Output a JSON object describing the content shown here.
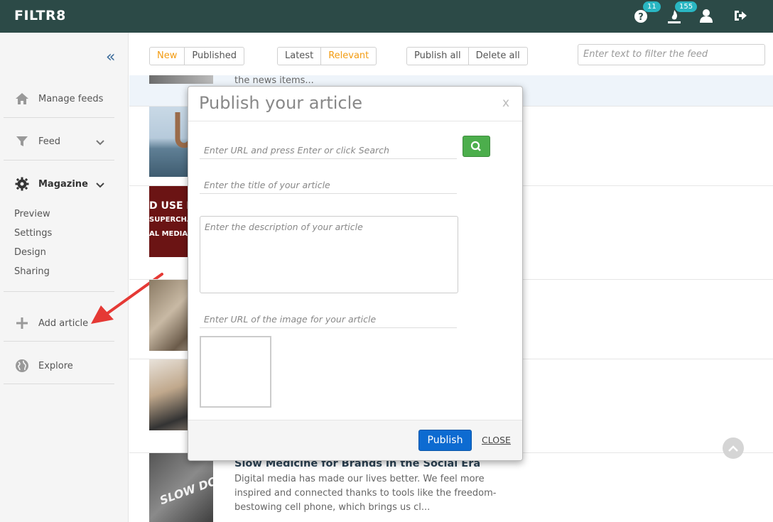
{
  "app": {
    "logo": "FILTR8"
  },
  "topbar": {
    "help_badge": "11",
    "notifications_badge": "155",
    "icons": [
      "question-circle-icon",
      "fire-icon",
      "user-icon",
      "sign-out-icon"
    ]
  },
  "sidebar": {
    "manage_feeds": "Manage feeds",
    "feed": "Feed",
    "magazine": "Magazine",
    "magazine_items": [
      "Preview",
      "Settings",
      "Design",
      "Sharing"
    ],
    "add_article": "Add article",
    "explore": "Explore"
  },
  "toolbar": {
    "new": "New",
    "published": "Published",
    "latest": "Latest",
    "relevant": "Relevant",
    "publish_all": "Publish all",
    "delete_all": "Delete all",
    "filter_placeholder": "Enter text to filter the feed"
  },
  "feed": {
    "top_snippet": "the news items...",
    "thumb2_text": [
      "D USE PI",
      "SUPERCHA",
      "AL MEDIA"
    ],
    "thumb6_text": "SLOW DOWN",
    "last_item": {
      "title": "Slow Medicine for Brands in the Social Era",
      "description": "Digital media has made our lives better. We feel more inspired and connected thanks to tools like the freedom-bestowing cell phone, which brings us cl..."
    }
  },
  "modal": {
    "title": "Publish your article",
    "close_x": "x",
    "url_placeholder": "Enter URL and press Enter or click Search",
    "title_placeholder": "Enter the title of your article",
    "description_placeholder": "Enter the description of your article",
    "image_placeholder": "Enter URL of the image for your article",
    "publish": "Publish",
    "close": "CLOSE"
  },
  "colors": {
    "topbar": "#2c4a47",
    "badge": "#29b6c2",
    "accent_orange": "#f39c12",
    "search_green": "#4cae4c",
    "publish_blue": "#0d6bd1",
    "annotation_arrow": "#e53935"
  }
}
